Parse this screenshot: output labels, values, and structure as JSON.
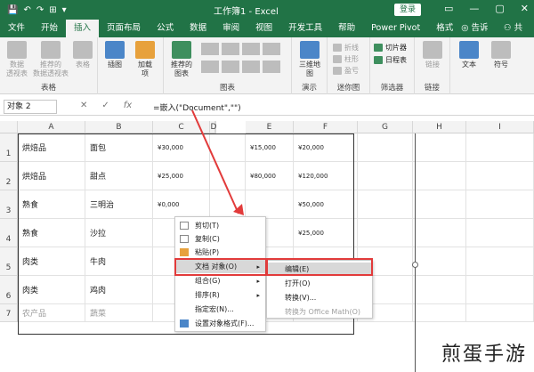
{
  "titlebar": {
    "title": "工作簿1 - Excel",
    "login": "登录",
    "qat": [
      "💾",
      "↶",
      "↷",
      "⊞",
      "▾"
    ],
    "window_buttons": [
      "▭",
      "—",
      "▢",
      "✕"
    ]
  },
  "tabs": [
    "文件",
    "开始",
    "插入",
    "页面布局",
    "公式",
    "数据",
    "审阅",
    "视图",
    "开发工具",
    "帮助",
    "Power Pivot",
    "格式"
  ],
  "tabs_right": {
    "tell": "告诉我",
    "share": "共享"
  },
  "ribbon": {
    "groups": [
      "表格",
      "插图",
      "图表",
      "演示",
      "迷你图",
      "筛选器",
      "链接"
    ],
    "buttons": {
      "pivot": "数据\n透视表",
      "recommended_pivot": "推荐的\n数据透视表",
      "table": "表格",
      "illustration": "插图",
      "addins": "加载\n项",
      "recommended_charts": "推荐的\n图表",
      "map": "三维地\n图",
      "slicer": "切片器",
      "timeline": "日程表",
      "link": "链接",
      "text": "文本",
      "symbol": "符号"
    },
    "sparklines": [
      "折线",
      "柱形",
      "盈亏"
    ]
  },
  "formula_bar": {
    "name_box": "对象 2",
    "formula": "=嵌入(\"Document\",\"\")",
    "cancel": "✕",
    "enter": "✓",
    "fx": "fx"
  },
  "columns": [
    "A",
    "B",
    "C",
    "D",
    "E",
    "F",
    "G",
    "H",
    "I"
  ],
  "rows": [
    {
      "num": "1",
      "a": "烘焙品",
      "b": "面包",
      "c": "¥30,000",
      "d": "",
      "e": "¥15,000",
      "f": "¥20,000"
    },
    {
      "num": "2",
      "a": "烘焙品",
      "b": "甜点",
      "c": "¥25,000",
      "d": "",
      "e": "¥80,000",
      "f": "¥120,000"
    },
    {
      "num": "3",
      "a": "熟食",
      "b": "三明治",
      "c": "¥0,000",
      "d": "",
      "e": "",
      "f": "¥50,000"
    },
    {
      "num": "4",
      "a": "熟食",
      "b": "沙拉",
      "c": "",
      "d": "",
      "e": "",
      "f": "¥25,000"
    },
    {
      "num": "5",
      "a": "肉类",
      "b": "牛肉",
      "c": "",
      "d": "",
      "e": "",
      "f": ""
    },
    {
      "num": "6",
      "a": "肉类",
      "b": "鸡肉",
      "c": "",
      "d": "",
      "e": "",
      "f": ""
    },
    {
      "num": "7",
      "a": "农产品",
      "b": "蔬菜",
      "c": "",
      "d": "",
      "e": "",
      "f": ""
    }
  ],
  "context_menu": {
    "items": [
      {
        "label": "剪切(T)"
      },
      {
        "label": "复制(C)"
      },
      {
        "label": "粘贴(P)"
      },
      {
        "label": "文档 对象(O)",
        "arrow": "▸"
      },
      {
        "label": "组合(G)",
        "arrow": "▸"
      },
      {
        "label": "排序(R)",
        "arrow": "▸"
      },
      {
        "label": "指定宏(N)..."
      },
      {
        "label": "设置对象格式(F)..."
      }
    ],
    "submenu": [
      {
        "label": "编辑(E)"
      },
      {
        "label": "打开(O)"
      },
      {
        "label": "转换(V)..."
      },
      {
        "label": "转换为 Office Math(O)"
      }
    ]
  },
  "watermark": "煎蛋手游",
  "colors": {
    "excel_green": "#217346",
    "highlight_red": "#e23b3b"
  }
}
